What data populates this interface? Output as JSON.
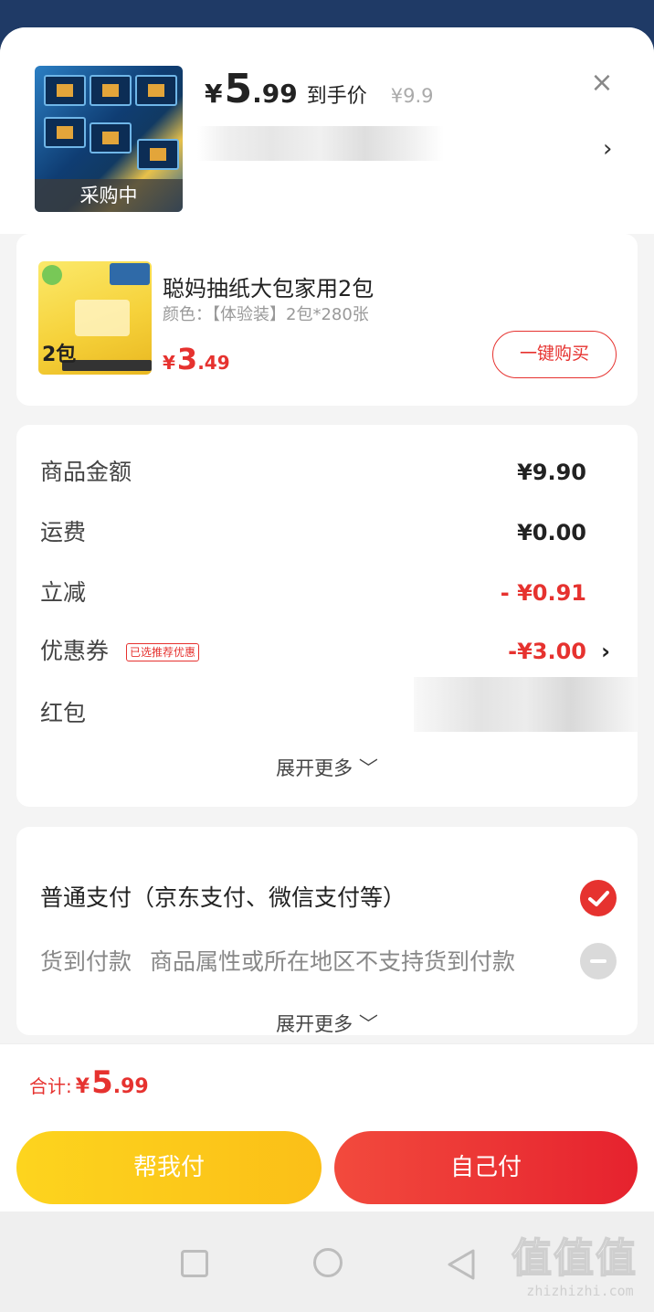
{
  "header": {
    "thumb_label": "采购中",
    "price": {
      "currency": "¥",
      "int": "5",
      "dec": ".99"
    },
    "price_tag": "到手价",
    "original_price": "¥9.9",
    "close_icon": "×",
    "chevron": "›"
  },
  "product": {
    "name": "聪妈抽纸大包家用2包",
    "spec": "颜色：【体验装】2包*280张",
    "price": {
      "currency": "¥",
      "int": "3",
      "dec": ".49"
    },
    "thumb_number": "2包",
    "buy_now": "一键购买"
  },
  "fees": {
    "goods_amount": {
      "label": "商品金额",
      "value": "¥9.90"
    },
    "shipping": {
      "label": "运费",
      "value": "¥0.00"
    },
    "instant_discount": {
      "label": "立减",
      "value": "- ¥0.91"
    },
    "coupon": {
      "label": "优惠券",
      "tag": "已选推荐优惠",
      "value": "-¥3.00",
      "chevron": "›"
    },
    "red_packet": {
      "label": "红包"
    },
    "expand": "展开更多 ﹀"
  },
  "payment": {
    "normal": "普通支付（京东支付、微信支付等）",
    "cod_label": "货到付款",
    "cod_note": "商品属性或所在地区不支持货到付款",
    "expand": "展开更多 ﹀"
  },
  "footer": {
    "total_label": "合计:",
    "total": {
      "currency": "¥",
      "int": "5",
      "dec": ".99"
    },
    "help_pay": "帮我付",
    "self_pay": "自己付"
  },
  "watermark": {
    "glyphs": "值值值",
    "site": "zhizhizhi.com"
  },
  "colors": {
    "accent_red": "#e6322f",
    "accent_yellow": "#fbc31a"
  },
  "icons": [
    "close-icon",
    "chevron-right-icon",
    "check-circle-icon",
    "minus-circle-icon",
    "nav-square-icon",
    "nav-circle-icon",
    "nav-back-icon"
  ]
}
